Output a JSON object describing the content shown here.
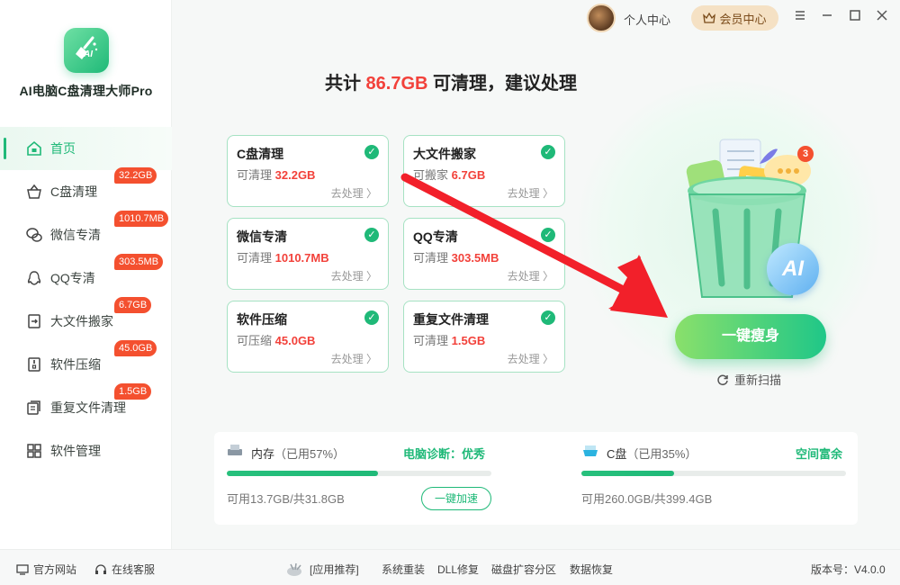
{
  "app": {
    "title": "AI电脑C盘清理大师Pro"
  },
  "sidebar": {
    "items": [
      {
        "label": "首页",
        "icon": "home-icon",
        "badge": ""
      },
      {
        "label": "C盘清理",
        "icon": "basket-icon",
        "badge": "32.2GB"
      },
      {
        "label": "微信专清",
        "icon": "wechat-icon",
        "badge": "1010.7MB"
      },
      {
        "label": "QQ专清",
        "icon": "qq-icon",
        "badge": "303.5MB"
      },
      {
        "label": "大文件搬家",
        "icon": "move-file-icon",
        "badge": "6.7GB"
      },
      {
        "label": "软件压缩",
        "icon": "compress-icon",
        "badge": "45.0GB"
      },
      {
        "label": "重复文件清理",
        "icon": "duplicate-file-icon",
        "badge": "1.5GB"
      },
      {
        "label": "软件管理",
        "icon": "apps-grid-icon",
        "badge": ""
      }
    ]
  },
  "topbar": {
    "user_center": "个人中心",
    "vip": "会员中心"
  },
  "headline": {
    "prefix": "共计 ",
    "amount": "86.7GB",
    "suffix": " 可清理，建议处理"
  },
  "cards": [
    {
      "title": "C盘清理",
      "amount_label": "可清理",
      "amount": "32.2GB",
      "action": "去处理 〉"
    },
    {
      "title": "大文件搬家",
      "amount_label": "可搬家",
      "amount": "6.7GB",
      "action": "去处理 〉"
    },
    {
      "title": "微信专清",
      "amount_label": "可清理",
      "amount": "1010.7MB",
      "action": "去处理 〉"
    },
    {
      "title": "QQ专清",
      "amount_label": "可清理",
      "amount": "303.5MB",
      "action": "去处理 〉"
    },
    {
      "title": "软件压缩",
      "amount_label": "可压缩",
      "amount": "45.0GB",
      "action": "去处理 〉"
    },
    {
      "title": "重复文件清理",
      "amount_label": "可清理",
      "amount": "1.5GB",
      "action": "去处理 〉"
    }
  ],
  "main": {
    "oneclick": "一键瘦身",
    "rescan": "重新扫描",
    "notify_count": "3",
    "ai_label": "AI"
  },
  "memory": {
    "label": "内存",
    "used": "（已用57%）",
    "used_fraction": 0.57,
    "status": "电脑诊断：优秀",
    "available": "可用13.7GB/共31.8GB",
    "speed_button": "一键加速"
  },
  "disk": {
    "label": "C盘",
    "used": "（已用35%）",
    "used_fraction": 0.35,
    "status": "空间富余",
    "available": "可用260.0GB/共399.4GB"
  },
  "footer": {
    "website": "官方网站",
    "support": "在线客服",
    "recommend": "[应用推荐]",
    "links": [
      "系统重装",
      "DLL修复",
      "磁盘扩容分区",
      "数据恢复"
    ],
    "version": "版本号：V4.0.0"
  },
  "colors": {
    "accent": "#1fb978",
    "alert": "#f2413a",
    "badge": "#f4502f"
  }
}
